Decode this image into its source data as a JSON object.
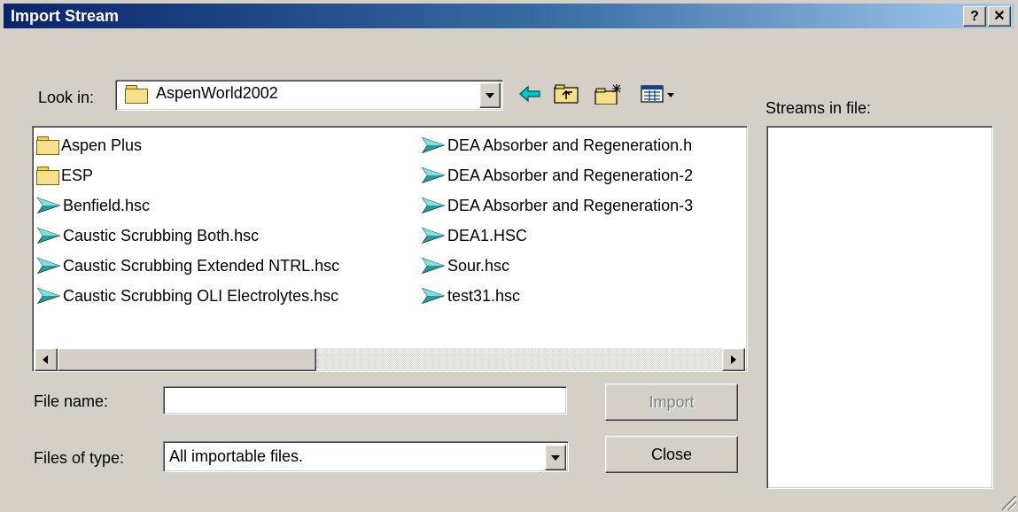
{
  "window": {
    "title": "Import Stream",
    "help_glyph": "?",
    "close_glyph": "✕"
  },
  "look_in": {
    "label": "Look in:",
    "value": "AspenWorld2002"
  },
  "files": {
    "column1": [
      {
        "name": "Aspen Plus",
        "icon": "folder-icon"
      },
      {
        "name": "ESP",
        "icon": "folder-icon"
      },
      {
        "name": "Benfield.hsc",
        "icon": "hysys-file-icon"
      },
      {
        "name": "Caustic Scrubbing Both.hsc",
        "icon": "hysys-file-icon"
      },
      {
        "name": "Caustic Scrubbing Extended NTRL.hsc",
        "icon": "hysys-file-icon"
      },
      {
        "name": "Caustic Scrubbing OLI Electrolytes.hsc",
        "icon": "hysys-file-icon"
      }
    ],
    "column2": [
      {
        "name": "DEA Absorber and Regeneration.h",
        "icon": "hysys-file-icon"
      },
      {
        "name": "DEA Absorber and Regeneration-2",
        "icon": "hysys-file-icon"
      },
      {
        "name": "DEA Absorber and Regeneration-3",
        "icon": "hysys-file-icon"
      },
      {
        "name": "DEA1.HSC",
        "icon": "hysys-file-icon"
      },
      {
        "name": "Sour.hsc",
        "icon": "hysys-file-icon"
      },
      {
        "name": "test31.hsc",
        "icon": "hysys-file-icon"
      }
    ]
  },
  "streams_panel": {
    "label": "Streams in file:"
  },
  "file_name": {
    "label": "File name:",
    "value": ""
  },
  "file_type": {
    "label": "Files of type:",
    "value": "All importable files."
  },
  "buttons": {
    "import": "Import",
    "close": "Close"
  },
  "colors": {
    "title_start": "#0a246a",
    "title_end": "#a6caf0",
    "face": "#d4d0c8",
    "file_icon": "#2a9a9a"
  }
}
